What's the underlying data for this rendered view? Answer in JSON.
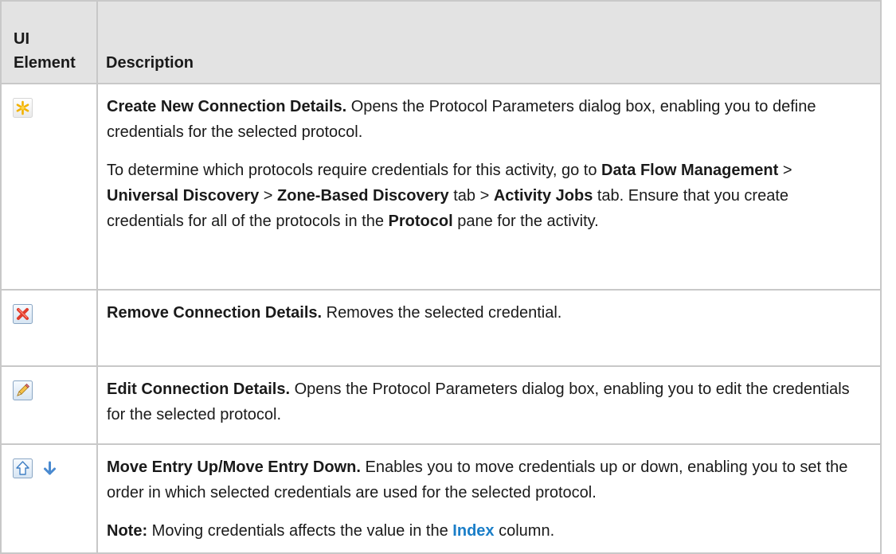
{
  "table": {
    "header_element_line1": "UI",
    "header_element_line2": "Element",
    "header_description": "Description"
  },
  "rows": {
    "create": {
      "icon": "asterisk-new-icon",
      "title": "Create New Connection Details.",
      "text": " Opens the Protocol Parameters dialog box, enabling you to define credentials for the selected protocol.",
      "p2_intro": "To determine which protocols require credentials for this activity, go to ",
      "p2_dfm": "Data Flow Management",
      "p2_gt1": " > ",
      "p2_ud": "Universal Discovery",
      "p2_gt2": " > ",
      "p2_zbd": "Zone-Based Discovery",
      "p2_tab1": " tab > ",
      "p2_aj": "Activity Jobs",
      "p2_tab2": " tab. Ensure that you create credentials for all of the protocols in the ",
      "p2_protocol": "Protocol",
      "p2_end": " pane for the activity."
    },
    "remove": {
      "icon": "red-x-delete-icon",
      "title": "Remove Connection Details.",
      "text": " Removes the selected credential."
    },
    "edit": {
      "icon": "pencil-edit-icon",
      "title": "Edit Connection Details.",
      "text": " Opens the Protocol Parameters dialog box, enabling you to edit the credentials for the selected protocol."
    },
    "move": {
      "icons": [
        "arrow-up-icon",
        "arrow-down-icon"
      ],
      "title": "Move Entry Up/Move Entry Down.",
      "text": " Enables you to move credentials up or down, enabling you to set the order in which selected credentials are used for the selected protocol.",
      "note_label": "Note:",
      "note_text": " Moving credentials affects the value in the ",
      "note_link": "Index",
      "note_end": " column."
    }
  },
  "colors": {
    "header_bg": "#e3e3e3",
    "border": "#c8c8c8",
    "link": "#1a7ec8"
  }
}
